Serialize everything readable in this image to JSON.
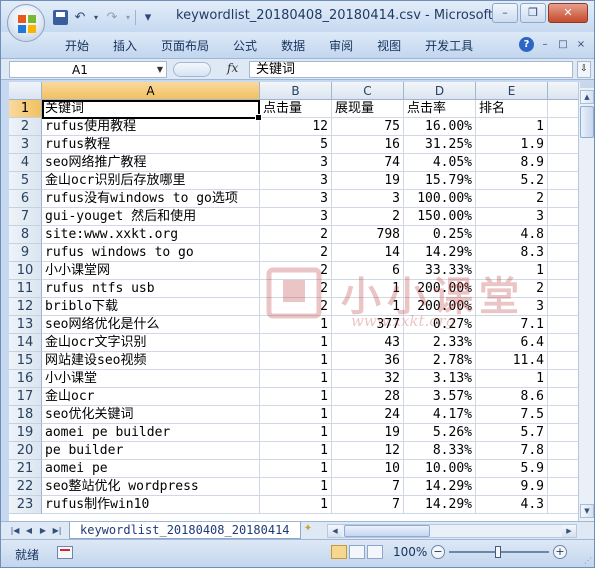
{
  "window": {
    "title": "keywordlist_20180408_20180414.csv - Microsoft...",
    "minimize_label": "–",
    "restore_label": "❒",
    "close_label": "✕"
  },
  "qat": {
    "undo": "↶",
    "redo": "↷",
    "customize": "▾"
  },
  "ribbon": {
    "tabs": [
      "开始",
      "插入",
      "页面布局",
      "公式",
      "数据",
      "审阅",
      "视图",
      "开发工具"
    ],
    "help": "?",
    "min": "–",
    "restore": "□",
    "close": "×"
  },
  "formula_bar": {
    "name_box": "A1",
    "fx": "fx",
    "content": "关键词"
  },
  "columns": [
    "A",
    "B",
    "C",
    "D",
    "E"
  ],
  "rows": [
    {
      "n": "1",
      "a": "关键词",
      "b": "点击量",
      "c": "展现量",
      "d": "点击率",
      "e": "排名"
    },
    {
      "n": "2",
      "a": "rufus使用教程",
      "b": "12",
      "c": "75",
      "d": "16.00%",
      "e": "1"
    },
    {
      "n": "3",
      "a": "rufus教程",
      "b": "5",
      "c": "16",
      "d": "31.25%",
      "e": "1.9"
    },
    {
      "n": "4",
      "a": "seo网络推广教程",
      "b": "3",
      "c": "74",
      "d": "4.05%",
      "e": "8.9"
    },
    {
      "n": "5",
      "a": "金山ocr识别后存放哪里",
      "b": "3",
      "c": "19",
      "d": "15.79%",
      "e": "5.2"
    },
    {
      "n": "6",
      "a": "rufus没有windows to go选项",
      "b": "3",
      "c": "3",
      "d": "100.00%",
      "e": "2"
    },
    {
      "n": "7",
      "a": "gui-youget 然后和使用",
      "b": "3",
      "c": "2",
      "d": "150.00%",
      "e": "3"
    },
    {
      "n": "8",
      "a": "site:www.xxkt.org",
      "b": "2",
      "c": "798",
      "d": "0.25%",
      "e": "4.8"
    },
    {
      "n": "9",
      "a": "rufus windows to go",
      "b": "2",
      "c": "14",
      "d": "14.29%",
      "e": "8.3"
    },
    {
      "n": "10",
      "a": "小小课堂网",
      "b": "2",
      "c": "6",
      "d": "33.33%",
      "e": "1"
    },
    {
      "n": "11",
      "a": "rufus ntfs usb",
      "b": "2",
      "c": "1",
      "d": "200.00%",
      "e": "2"
    },
    {
      "n": "12",
      "a": "briblo下载",
      "b": "2",
      "c": "1",
      "d": "200.00%",
      "e": "3"
    },
    {
      "n": "13",
      "a": "seo网络优化是什么",
      "b": "1",
      "c": "377",
      "d": "0.27%",
      "e": "7.1"
    },
    {
      "n": "14",
      "a": "金山ocr文字识别",
      "b": "1",
      "c": "43",
      "d": "2.33%",
      "e": "6.4"
    },
    {
      "n": "15",
      "a": "网站建设seo视频",
      "b": "1",
      "c": "36",
      "d": "2.78%",
      "e": "11.4"
    },
    {
      "n": "16",
      "a": "小小课堂",
      "b": "1",
      "c": "32",
      "d": "3.13%",
      "e": "1"
    },
    {
      "n": "17",
      "a": "金山ocr",
      "b": "1",
      "c": "28",
      "d": "3.57%",
      "e": "8.6"
    },
    {
      "n": "18",
      "a": "seo优化关键词",
      "b": "1",
      "c": "24",
      "d": "4.17%",
      "e": "7.5"
    },
    {
      "n": "19",
      "a": "aomei pe builder",
      "b": "1",
      "c": "19",
      "d": "5.26%",
      "e": "5.7"
    },
    {
      "n": "20",
      "a": "pe builder",
      "b": "1",
      "c": "12",
      "d": "8.33%",
      "e": "7.8"
    },
    {
      "n": "21",
      "a": "aomei pe",
      "b": "1",
      "c": "10",
      "d": "10.00%",
      "e": "5.9"
    },
    {
      "n": "22",
      "a": "seo整站优化 wordpress",
      "b": "1",
      "c": "7",
      "d": "14.29%",
      "e": "9.9"
    },
    {
      "n": "23",
      "a": "rufus制作win10",
      "b": "1",
      "c": "7",
      "d": "14.29%",
      "e": "4.3"
    }
  ],
  "watermark": {
    "text": "小小课堂",
    "url": "www.xxkt.org"
  },
  "sheet_tab": "keywordlist_20180408_20180414",
  "status": {
    "ready": "就绪",
    "zoom": "100%",
    "zoom_minus": "−",
    "zoom_plus": "+"
  },
  "colors": {
    "selected_header": "#f1c15f",
    "grid_line": "#d0d7e5",
    "watermark": "#b33333"
  }
}
